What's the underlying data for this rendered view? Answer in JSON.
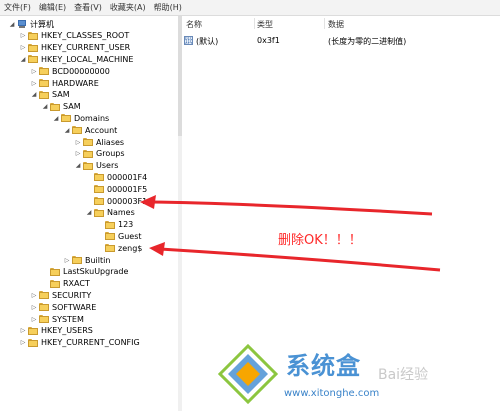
{
  "menubar": {
    "items": [
      "文件(F)",
      "编辑(E)",
      "查看(V)",
      "收藏夹(A)",
      "帮助(H)"
    ]
  },
  "tree": [
    {
      "label": "计算机",
      "icon": "computer-icon",
      "expander": "expanded"
    },
    {
      "label": "HKEY_CLASSES_ROOT",
      "icon": "folder-icon",
      "expander": "collapsed"
    },
    {
      "label": "HKEY_CURRENT_USER",
      "icon": "folder-icon",
      "expander": "collapsed"
    },
    {
      "label": "HKEY_LOCAL_MACHINE",
      "icon": "folder-icon",
      "expander": "expanded"
    },
    {
      "label": "BCD00000000",
      "icon": "folder-icon",
      "expander": "collapsed"
    },
    {
      "label": "HARDWARE",
      "icon": "folder-icon",
      "expander": "collapsed"
    },
    {
      "label": "SAM",
      "icon": "folder-icon",
      "expander": "expanded"
    },
    {
      "label": "SAM",
      "icon": "folder-icon",
      "expander": "expanded"
    },
    {
      "label": "Domains",
      "icon": "folder-icon",
      "expander": "expanded"
    },
    {
      "label": "Account",
      "icon": "folder-icon",
      "expander": "expanded"
    },
    {
      "label": "Aliases",
      "icon": "folder-icon",
      "expander": "collapsed"
    },
    {
      "label": "Groups",
      "icon": "folder-icon",
      "expander": "collapsed"
    },
    {
      "label": "Users",
      "icon": "folder-icon",
      "expander": "expanded"
    },
    {
      "label": "000001F4",
      "icon": "folder-icon",
      "expander": "none"
    },
    {
      "label": "000001F5",
      "icon": "folder-icon",
      "expander": "none"
    },
    {
      "label": "000003F1",
      "icon": "folder-icon",
      "expander": "none"
    },
    {
      "label": "Names",
      "icon": "folder-icon",
      "expander": "expanded"
    },
    {
      "label": "123",
      "icon": "folder-icon",
      "expander": "none"
    },
    {
      "label": "Guest",
      "icon": "folder-icon",
      "expander": "none"
    },
    {
      "label": "zeng$",
      "icon": "folder-icon",
      "expander": "none"
    },
    {
      "label": "Builtin",
      "icon": "folder-icon",
      "expander": "collapsed"
    },
    {
      "label": "LastSkuUpgrade",
      "icon": "folder-icon",
      "expander": "none"
    },
    {
      "label": "RXACT",
      "icon": "folder-icon",
      "expander": "none"
    },
    {
      "label": "SECURITY",
      "icon": "folder-icon",
      "expander": "collapsed"
    },
    {
      "label": "SOFTWARE",
      "icon": "folder-icon",
      "expander": "collapsed"
    },
    {
      "label": "SYSTEM",
      "icon": "folder-icon",
      "expander": "collapsed"
    },
    {
      "label": "HKEY_USERS",
      "icon": "folder-icon",
      "expander": "collapsed"
    },
    {
      "label": "HKEY_CURRENT_CONFIG",
      "icon": "folder-icon",
      "expander": "collapsed"
    }
  ],
  "list": {
    "headers": {
      "name": "名称",
      "type": "类型",
      "data": "数据"
    },
    "rows": [
      {
        "name": "(默认)",
        "type": "0x3f1",
        "data": "(长度为零的二进制值)",
        "icon": "binary-value-icon"
      }
    ]
  },
  "annotation": {
    "text": "删除OK！！！",
    "color": "#ff2a2a"
  },
  "watermark": {
    "brand": "系统盒",
    "url": "www.xitonghe.com",
    "faint": "Bai经验",
    "icon": "xitonghe-logo-icon"
  }
}
